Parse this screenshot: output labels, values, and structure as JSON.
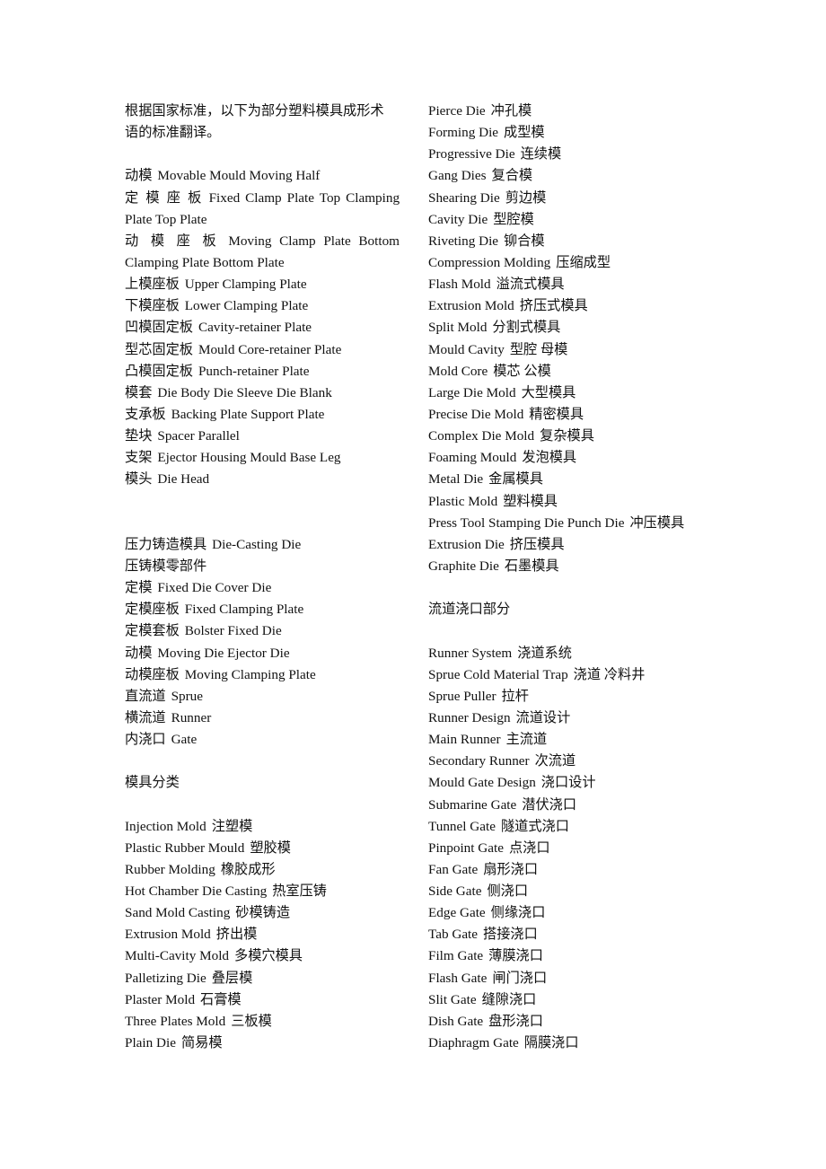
{
  "document": {
    "left_column": [
      {
        "type": "text",
        "text": "根据国家标准，以下为部分塑料模具成形术"
      },
      {
        "type": "text",
        "text": "语的标准翻译。"
      },
      {
        "type": "blank"
      },
      {
        "type": "entry",
        "zh": "动模",
        "en": "Movable Mould Moving Half"
      },
      {
        "type": "entry",
        "zh": "定模座板",
        "en": "Fixed Clamp Plate Top Clamping",
        "justify": true
      },
      {
        "type": "text",
        "text": "Plate Top Plate"
      },
      {
        "type": "entry",
        "zh": "动模座板",
        "en": "Moving Clamp Plate Bottom",
        "justify": true
      },
      {
        "type": "text",
        "text": "Clamping Plate Bottom Plate"
      },
      {
        "type": "entry",
        "zh": "上模座板",
        "en": "Upper Clamping Plate"
      },
      {
        "type": "entry",
        "zh": "下模座板",
        "en": "Lower Clamping Plate"
      },
      {
        "type": "entry",
        "zh": "凹模固定板",
        "en": "Cavity-retainer Plate"
      },
      {
        "type": "entry",
        "zh": "型芯固定板",
        "en": "Mould Core-retainer Plate"
      },
      {
        "type": "entry",
        "zh": "凸模固定板",
        "en": "Punch-retainer Plate"
      },
      {
        "type": "entry",
        "zh": "模套",
        "en": "Die Body Die Sleeve Die Blank"
      },
      {
        "type": "entry",
        "zh": "支承板",
        "en": "Backing Plate Support Plate"
      },
      {
        "type": "entry",
        "zh": "垫块",
        "en": "Spacer Parallel"
      },
      {
        "type": "entry",
        "zh": "支架",
        "en": "Ejector Housing Mould Base Leg"
      },
      {
        "type": "entry",
        "zh": "模头",
        "en": "Die Head"
      },
      {
        "type": "blank"
      },
      {
        "type": "blank"
      },
      {
        "type": "entry",
        "zh": "压力铸造模具",
        "en": "Die-Casting Die"
      },
      {
        "type": "text",
        "text": "压铸模零部件"
      },
      {
        "type": "entry",
        "zh": "定模",
        "en": "Fixed Die Cover Die"
      },
      {
        "type": "entry",
        "zh": "定模座板",
        "en": "Fixed Clamping Plate"
      },
      {
        "type": "entry",
        "zh": "定模套板",
        "en": "Bolster Fixed Die"
      },
      {
        "type": "entry",
        "zh": "动模",
        "en": "Moving Die Ejector Die"
      },
      {
        "type": "entry",
        "zh": "动模座板",
        "en": "Moving Clamping Plate"
      },
      {
        "type": "entry",
        "zh": "直流道",
        "en": "Sprue"
      },
      {
        "type": "entry",
        "zh": "横流道",
        "en": "Runner"
      },
      {
        "type": "entry",
        "zh": "内浇口",
        "en": "Gate"
      },
      {
        "type": "blank"
      },
      {
        "type": "text",
        "text": "模具分类"
      },
      {
        "type": "blank"
      },
      {
        "type": "entry_en_first",
        "en": "Injection Mold",
        "zh": "注塑模"
      },
      {
        "type": "entry_en_first",
        "en": "Plastic Rubber Mould",
        "zh": "塑胶模"
      },
      {
        "type": "entry_en_first",
        "en": "Rubber Molding",
        "zh": "橡胶成形"
      },
      {
        "type": "entry_en_first",
        "en": "Hot Chamber Die Casting",
        "zh": "热室压铸"
      },
      {
        "type": "entry_en_first",
        "en": "Sand Mold Casting",
        "zh": "砂模铸造"
      },
      {
        "type": "entry_en_first",
        "en": "Extrusion Mold",
        "zh": "挤出模"
      },
      {
        "type": "entry_en_first",
        "en": "Multi-Cavity Mold",
        "zh": "多模穴模具"
      },
      {
        "type": "entry_en_first",
        "en": "Palletizing Die",
        "zh": "叠层模"
      },
      {
        "type": "entry_en_first",
        "en": "Plaster Mold",
        "zh": "石膏模"
      },
      {
        "type": "entry_en_first",
        "en": "Three Plates Mold",
        "zh": "三板模"
      },
      {
        "type": "entry_en_first",
        "en": "Plain Die",
        "zh": "简易模"
      }
    ],
    "right_column": [
      {
        "type": "entry_en_first",
        "en": "Pierce Die",
        "zh": "冲孔模"
      },
      {
        "type": "entry_en_first",
        "en": "Forming Die",
        "zh": "成型模"
      },
      {
        "type": "entry_en_first",
        "en": "Progressive Die",
        "zh": "连续模"
      },
      {
        "type": "entry_en_first",
        "en": "Gang Dies",
        "zh": "复合模"
      },
      {
        "type": "entry_en_first",
        "en": "Shearing Die",
        "zh": "剪边模"
      },
      {
        "type": "entry_en_first",
        "en": "Cavity Die",
        "zh": "型腔模"
      },
      {
        "type": "entry_en_first",
        "en": "Riveting Die",
        "zh": "铆合模"
      },
      {
        "type": "entry_en_first",
        "en": "Compression Molding",
        "zh": "压缩成型"
      },
      {
        "type": "entry_en_first",
        "en": "Flash Mold",
        "zh": "溢流式模具"
      },
      {
        "type": "entry_en_first",
        "en": "Extrusion Mold",
        "zh": "挤压式模具"
      },
      {
        "type": "entry_en_first",
        "en": "Split Mold",
        "zh": "分割式模具"
      },
      {
        "type": "entry_en_first",
        "en": "Mould Cavity",
        "zh": "型腔  母模"
      },
      {
        "type": "entry_en_first",
        "en": "Mold Core",
        "zh": "模芯  公模"
      },
      {
        "type": "entry_en_first",
        "en": "Large Die Mold",
        "zh": "大型模具"
      },
      {
        "type": "entry_en_first",
        "en": "Precise Die Mold",
        "zh": "精密模具"
      },
      {
        "type": "entry_en_first",
        "en": "Complex Die Mold",
        "zh": "复杂模具"
      },
      {
        "type": "entry_en_first",
        "en": "Foaming Mould",
        "zh": "发泡模具"
      },
      {
        "type": "entry_en_first",
        "en": "Metal Die",
        "zh": "金属模具"
      },
      {
        "type": "entry_en_first",
        "en": "Plastic Mold",
        "zh": "塑料模具"
      },
      {
        "type": "entry_en_first",
        "en": "Press Tool Stamping Die Punch Die",
        "zh": "冲压模具"
      },
      {
        "type": "entry_en_first",
        "en": "Extrusion Die",
        "zh": "挤压模具"
      },
      {
        "type": "entry_en_first",
        "en": "Graphite Die",
        "zh": "石墨模具"
      },
      {
        "type": "blank"
      },
      {
        "type": "text",
        "text": "流道浇口部分"
      },
      {
        "type": "blank"
      },
      {
        "type": "entry_en_first",
        "en": "Runner System",
        "zh": "浇道系统"
      },
      {
        "type": "entry_en_first",
        "en": "Sprue Cold Material Trap",
        "zh": "浇道  冷料井"
      },
      {
        "type": "entry_en_first",
        "en": "Sprue Puller",
        "zh": "拉杆"
      },
      {
        "type": "entry_en_first",
        "en": "Runner Design",
        "zh": "流道设计"
      },
      {
        "type": "entry_en_first",
        "en": "Main Runner",
        "zh": "主流道"
      },
      {
        "type": "entry_en_first",
        "en": "Secondary Runner",
        "zh": "次流道"
      },
      {
        "type": "entry_en_first",
        "en": "Mould Gate Design",
        "zh": "浇口设计"
      },
      {
        "type": "entry_en_first",
        "en": "Submarine Gate",
        "zh": "潜伏浇口"
      },
      {
        "type": "entry_en_first",
        "en": "Tunnel Gate",
        "zh": "隧道式浇口"
      },
      {
        "type": "entry_en_first",
        "en": "Pinpoint Gate",
        "zh": "点浇口"
      },
      {
        "type": "entry_en_first",
        "en": "Fan Gate",
        "zh": "扇形浇口"
      },
      {
        "type": "entry_en_first",
        "en": "Side Gate",
        "zh": "侧浇口"
      },
      {
        "type": "entry_en_first",
        "en": "Edge Gate",
        "zh": "侧缘浇口"
      },
      {
        "type": "entry_en_first",
        "en": "Tab Gate",
        "zh": "搭接浇口"
      },
      {
        "type": "entry_en_first",
        "en": "Film Gate",
        "zh": "薄膜浇口"
      },
      {
        "type": "entry_en_first",
        "en": "Flash Gate",
        "zh": "闸门浇口"
      },
      {
        "type": "entry_en_first",
        "en": "Slit Gate",
        "zh": "缝隙浇口"
      },
      {
        "type": "entry_en_first",
        "en": "Dish Gate",
        "zh": "盘形浇口"
      },
      {
        "type": "entry_en_first",
        "en": "Diaphragm Gate",
        "zh": "隔膜浇口"
      }
    ]
  }
}
